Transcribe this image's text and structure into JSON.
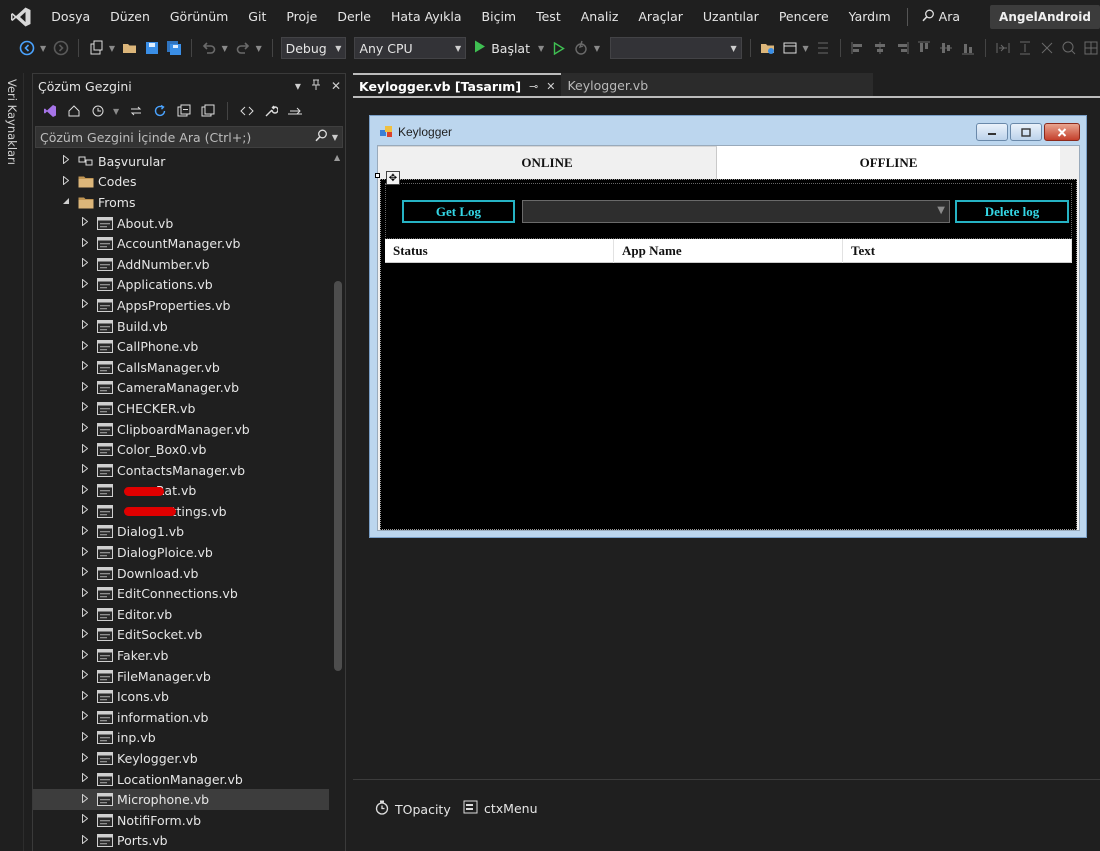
{
  "menu": {
    "items": [
      "Dosya",
      "Düzen",
      "Görünüm",
      "Git",
      "Proje",
      "Derle",
      "Hata Ayıkla",
      "Biçim",
      "Test",
      "Analiz",
      "Araçlar",
      "Uzantılar",
      "Pencere",
      "Yardım"
    ],
    "search_label": "Ara",
    "project_name": "AngelAndroid"
  },
  "toolbar": {
    "configuration": "Debug",
    "platform": "Any CPU",
    "start_label": "Başlat",
    "target": ""
  },
  "left_strip": {
    "label": "Veri Kaynakları"
  },
  "solution_explorer": {
    "title": "Çözüm Gezgini",
    "search_placeholder": "Çözüm Gezgini İçinde Ara (Ctrl+;)",
    "tree": [
      {
        "label": "Başvurular",
        "depth": 1,
        "icon": "references-icon",
        "expander": "collapsed"
      },
      {
        "label": "Codes",
        "depth": 1,
        "icon": "folder-icon",
        "expander": "collapsed"
      },
      {
        "label": "Froms",
        "depth": 1,
        "icon": "folder-icon",
        "expander": "expanded"
      },
      {
        "label": "About.vb",
        "depth": 2,
        "icon": "form-icon",
        "expander": "collapsed"
      },
      {
        "label": "AccountManager.vb",
        "depth": 2,
        "icon": "form-icon",
        "expander": "collapsed"
      },
      {
        "label": "AddNumber.vb",
        "depth": 2,
        "icon": "form-icon",
        "expander": "collapsed"
      },
      {
        "label": "Applications.vb",
        "depth": 2,
        "icon": "form-icon",
        "expander": "collapsed"
      },
      {
        "label": "AppsProperties.vb",
        "depth": 2,
        "icon": "form-icon",
        "expander": "collapsed"
      },
      {
        "label": "Build.vb",
        "depth": 2,
        "icon": "form-icon",
        "expander": "collapsed"
      },
      {
        "label": "CallPhone.vb",
        "depth": 2,
        "icon": "form-icon",
        "expander": "collapsed"
      },
      {
        "label": "CallsManager.vb",
        "depth": 2,
        "icon": "form-icon",
        "expander": "collapsed"
      },
      {
        "label": "CameraManager.vb",
        "depth": 2,
        "icon": "form-icon",
        "expander": "collapsed"
      },
      {
        "label": "CHECKER.vb",
        "depth": 2,
        "icon": "form-icon",
        "expander": "collapsed"
      },
      {
        "label": "ClipboardManager.vb",
        "depth": 2,
        "icon": "form-icon",
        "expander": "collapsed"
      },
      {
        "label": "Color_Box0.vb",
        "depth": 2,
        "icon": "form-icon",
        "expander": "collapsed"
      },
      {
        "label": "ContactsManager.vb",
        "depth": 2,
        "icon": "form-icon",
        "expander": "collapsed"
      },
      {
        "label": "Rat.vb",
        "depth": 2,
        "icon": "form-icon",
        "expander": "collapsed",
        "redacted": true
      },
      {
        "label": "Settings.vb",
        "depth": 2,
        "icon": "form-icon",
        "expander": "collapsed",
        "redacted": true
      },
      {
        "label": "Dialog1.vb",
        "depth": 2,
        "icon": "form-icon",
        "expander": "collapsed"
      },
      {
        "label": "DialogPloice.vb",
        "depth": 2,
        "icon": "form-icon",
        "expander": "collapsed"
      },
      {
        "label": "Download.vb",
        "depth": 2,
        "icon": "form-icon",
        "expander": "collapsed"
      },
      {
        "label": "EditConnections.vb",
        "depth": 2,
        "icon": "form-icon",
        "expander": "collapsed"
      },
      {
        "label": "Editor.vb",
        "depth": 2,
        "icon": "form-icon",
        "expander": "collapsed"
      },
      {
        "label": "EditSocket.vb",
        "depth": 2,
        "icon": "form-icon",
        "expander": "collapsed"
      },
      {
        "label": "Faker.vb",
        "depth": 2,
        "icon": "form-icon",
        "expander": "collapsed"
      },
      {
        "label": "FileManager.vb",
        "depth": 2,
        "icon": "form-icon",
        "expander": "collapsed"
      },
      {
        "label": "Icons.vb",
        "depth": 2,
        "icon": "form-icon",
        "expander": "collapsed"
      },
      {
        "label": "information.vb",
        "depth": 2,
        "icon": "form-icon",
        "expander": "collapsed"
      },
      {
        "label": "inp.vb",
        "depth": 2,
        "icon": "form-icon",
        "expander": "collapsed"
      },
      {
        "label": "Keylogger.vb",
        "depth": 2,
        "icon": "form-icon",
        "expander": "collapsed"
      },
      {
        "label": "LocationManager.vb",
        "depth": 2,
        "icon": "form-icon",
        "expander": "collapsed"
      },
      {
        "label": "Microphone.vb",
        "depth": 2,
        "icon": "form-icon",
        "expander": "collapsed",
        "selected": true
      },
      {
        "label": "NotifiForm.vb",
        "depth": 2,
        "icon": "form-icon",
        "expander": "collapsed"
      },
      {
        "label": "Ports.vb",
        "depth": 2,
        "icon": "form-icon",
        "expander": "collapsed"
      }
    ]
  },
  "document_tabs": {
    "active": "Keylogger.vb [Tasarım]",
    "inactive": "Keylogger.vb"
  },
  "form": {
    "title": "Keylogger",
    "tabs": {
      "online": "ONLINE",
      "offline": "OFFLINE"
    },
    "get_log_label": "Get Log",
    "delete_log_label": "Delete log",
    "combo_value": "",
    "columns": [
      "Status",
      "App Name",
      "Text"
    ]
  },
  "component_tray": {
    "items": [
      {
        "label": "TOpacity",
        "icon": "timer-icon"
      },
      {
        "label": "ctxMenu",
        "icon": "context-menu-icon"
      }
    ]
  },
  "colors": {
    "ide_background": "#1f1f1f",
    "form_accent_cyan": "#34d7e6",
    "form_border": "#bcd6ee",
    "redaction": "#e00000"
  }
}
